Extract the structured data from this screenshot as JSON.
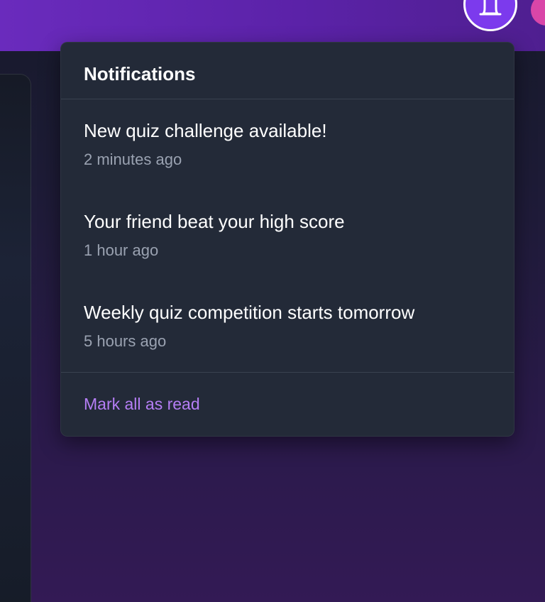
{
  "colors": {
    "header_bg": "#5b22a8",
    "dropdown_bg": "#232a38",
    "bell_button_bg": "#7c3aed",
    "avatar_bg": "#d946a8",
    "link": "#b57ef5",
    "muted_text": "#9aa2b1"
  },
  "header": {
    "bell_icon": "bell-icon"
  },
  "notifications": {
    "title": "Notifications",
    "items": [
      {
        "message": "New quiz challenge available!",
        "time": "2 minutes ago"
      },
      {
        "message": "Your friend beat your high score",
        "time": "1 hour ago"
      },
      {
        "message": "Weekly quiz competition starts tomorrow",
        "time": "5 hours ago"
      }
    ],
    "mark_all_read_label": "Mark all as read"
  }
}
